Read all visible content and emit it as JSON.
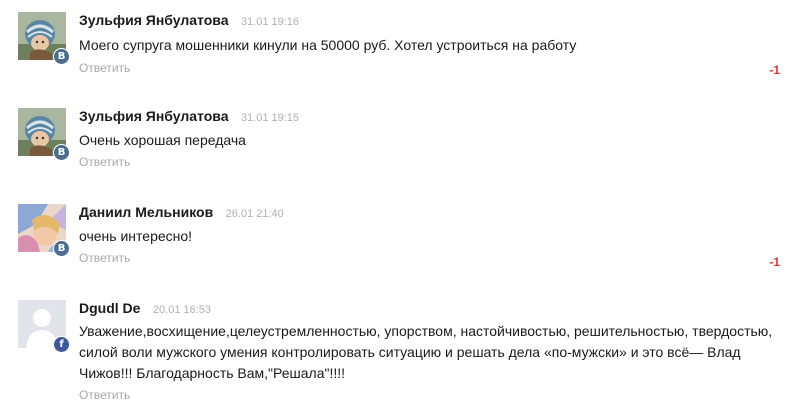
{
  "comments": [
    {
      "author": "Зульфия Янбулатова",
      "date": "31.01 19:16",
      "text": "Моего супруга мошенники кинули на 50000 руб. Хотел устроиться на работу",
      "reply": "Ответить",
      "rating": "-1",
      "network": "vk",
      "network_glyph": "B",
      "avatar_icon": "child-in-knit-hat-photo-icon"
    },
    {
      "author": "Зульфия Янбулатова",
      "date": "31.01 19:15",
      "text": "Очень хорошая передача",
      "reply": "Ответить",
      "network": "vk",
      "network_glyph": "B",
      "avatar_icon": "child-in-knit-hat-photo-icon"
    },
    {
      "author": "Даниил Мельников",
      "date": "26.01 21:40",
      "text": "очень интересно!",
      "reply": "Ответить",
      "rating": "-1",
      "network": "vk",
      "network_glyph": "B",
      "avatar_icon": "blurred-portrait-photo-icon"
    },
    {
      "author": "Dgudl De",
      "date": "20.01 16:53",
      "text_lines": [
        "Уважение,восхищение,целеустремленностью, упорством, настойчивостью, решительностью, твердостью,",
        "силой воли мужского умения контролировать ситуацию и решать дела «по-мужски» и это всё— Влад",
        "Чижов!!! Благодарность Вам,\"Решала\"!!!!"
      ],
      "reply": "Ответить",
      "network": "facebook",
      "network_glyph": "f",
      "avatar_icon": "default-user-silhouette-icon"
    }
  ],
  "colors": {
    "author": "#1a1a1a",
    "date": "#b0b0b0",
    "reply": "#a8a8a8",
    "rating_negative": "#e0352b",
    "vk_badge": "#4c6c91",
    "fb_badge": "#3b5998"
  }
}
